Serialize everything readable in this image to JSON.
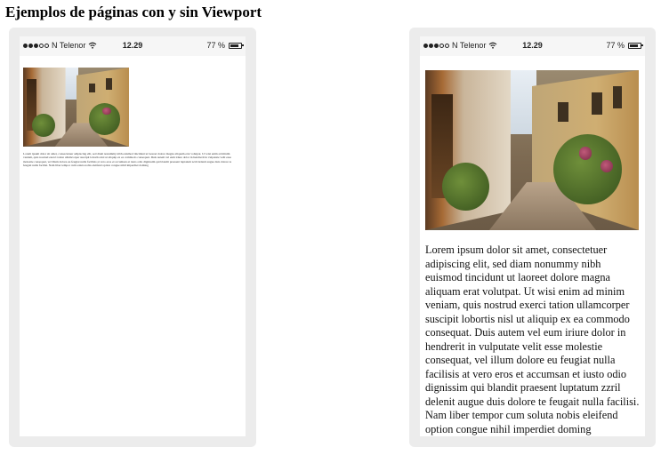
{
  "heading": "Ejemplos de páginas con y sin Viewport",
  "status_bar": {
    "carrier": "N Telenor",
    "time": "12.29",
    "battery": "77 %"
  },
  "lorem": "Lorem ipsum dolor sit amet, consectetuer adipiscing elit, sed diam nonummy nibh euismod tincidunt ut laoreet dolore magna aliquam erat volutpat. Ut wisi enim ad minim veniam, quis nostrud exerci tation ullamcorper suscipit lobortis nisl ut aliquip ex ea commodo consequat. Duis autem vel eum iriure dolor in hendrerit in vulputate velit esse molestie consequat, vel illum dolore eu feugiat nulla facilisis at vero eros et accumsan et iusto odio dignissim qui blandit praesent luptatum zzril delenit augue duis dolore te feugait nulla facilisi. Nam liber tempor cum soluta nobis eleifend option congue nihil imperdiet doming",
  "icons": {
    "signal": "signal-dots-icon",
    "wifi": "wifi-icon",
    "battery": "battery-icon"
  }
}
